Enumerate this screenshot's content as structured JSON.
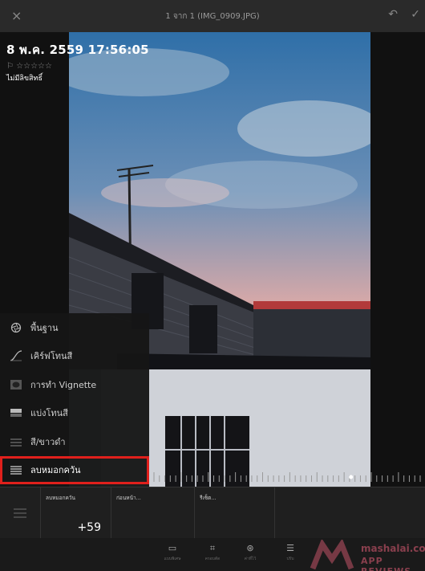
{
  "topbar": {
    "title": "1 จาก 1 (IMG_0909.JPG)",
    "close_glyph": "×",
    "undo_glyph": "↶",
    "done_glyph": "✓"
  },
  "photo_info": {
    "date": "8 พ.ค. 2559 17:56:05",
    "stars": "⚐ ☆☆☆☆☆",
    "rights": "ไม่มีลิขสิทธิ์"
  },
  "adjust_panel": {
    "items": [
      {
        "label": "พื้นฐาน",
        "icon": "aperture-icon"
      },
      {
        "label": "เคิร์ฟโทนสี",
        "icon": "curve-icon"
      },
      {
        "label": "การทำ Vignette",
        "icon": "vignette-icon"
      },
      {
        "label": "แบ่งโทนสี",
        "icon": "split-tone-icon"
      },
      {
        "label": "สี/ขาวดำ",
        "icon": "color-bw-icon"
      },
      {
        "label": "ลบหมอกควัน",
        "icon": "dehaze-icon"
      }
    ],
    "active_index": 5
  },
  "slider": {
    "value_fraction": 0.74
  },
  "bottom_row": {
    "cells": [
      {
        "label": "ลบหมอกควัน",
        "value": "+59"
      },
      {
        "label": "ก่อนหน้า...",
        "value": ""
      },
      {
        "label": "รีเซ็ต...",
        "value": ""
      }
    ]
  },
  "toolbar": {
    "items": [
      {
        "label": "แบบพิเศษ",
        "icon": "preset-icon"
      },
      {
        "label": "ครอบตัด",
        "icon": "crop-icon"
      },
      {
        "label": "ค่าที่ไว้",
        "icon": "presets-icon"
      },
      {
        "label": "ปรับ",
        "icon": "adjust-icon"
      }
    ]
  },
  "watermark": {
    "line1": "mashalai.com",
    "line2": "APP REVIEWS"
  },
  "colors": {
    "accent_red": "#e0201c"
  }
}
